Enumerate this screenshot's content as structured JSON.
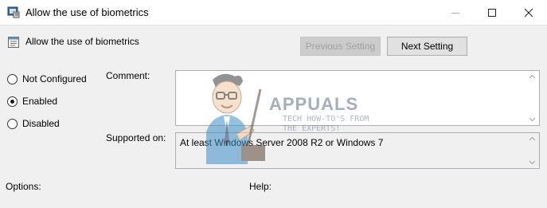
{
  "window": {
    "title": "Allow the use of biometrics",
    "controls": [
      "minimize",
      "maximize",
      "close"
    ]
  },
  "setting": {
    "title": "Allow the use of biometrics",
    "icon": "policy-setting-icon"
  },
  "buttons": {
    "previous_label": "Previous Setting",
    "next_label": "Next Setting"
  },
  "state": {
    "options": [
      {
        "label": "Not Configured",
        "checked": false
      },
      {
        "label": "Enabled",
        "checked": true
      },
      {
        "label": "Disabled",
        "checked": false
      }
    ]
  },
  "comment": {
    "label": "Comment:",
    "value": ""
  },
  "supported": {
    "label": "Supported on:",
    "value": "At least Windows Server 2008 R2 or Windows 7"
  },
  "panels": {
    "options_label": "Options:",
    "help_label": "Help:"
  },
  "watermark": {
    "brand": "APPUALS",
    "tagline_line1": "TECH HOW-TO'S FROM",
    "tagline_line2": "THE EXPERTS!"
  },
  "colors": {
    "window_bg": "#f0f0f0",
    "titlebar_bg": "#ffffff",
    "button_bg": "#e1e1e1",
    "textbox_border": "#abadb3"
  }
}
